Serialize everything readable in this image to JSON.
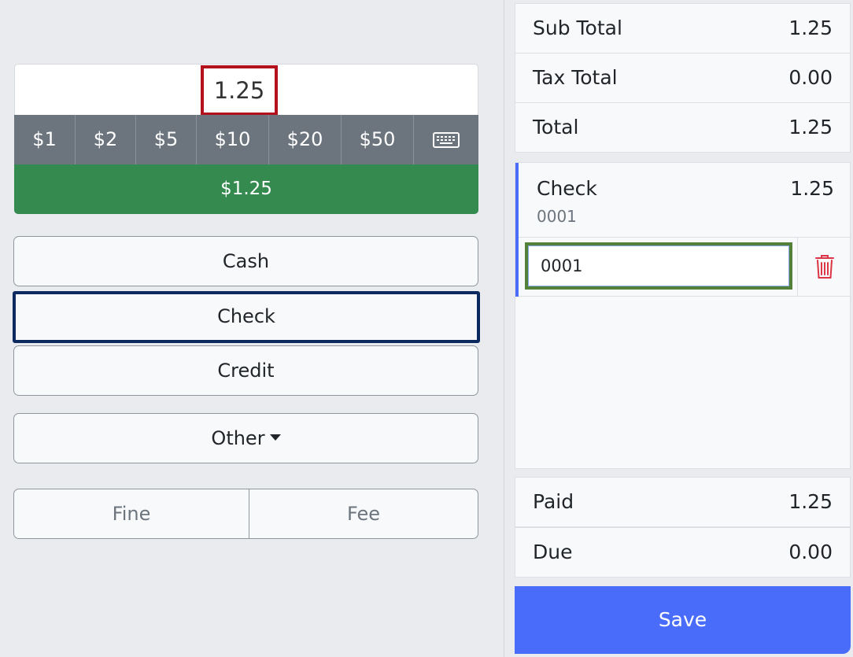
{
  "amount": {
    "value": "1.25"
  },
  "quick_amounts": [
    "$1",
    "$2",
    "$5",
    "$10",
    "$20",
    "$50"
  ],
  "keyboard_icon": "keyboard-icon",
  "exact_amount": "$1.25",
  "methods": {
    "cash": "Cash",
    "check": "Check",
    "credit": "Credit",
    "other": "Other"
  },
  "fine_fee": {
    "fine": "Fine",
    "fee": "Fee"
  },
  "summary": {
    "subtotal_label": "Sub Total",
    "subtotal_value": "1.25",
    "tax_label": "Tax Total",
    "tax_value": "0.00",
    "total_label": "Total",
    "total_value": "1.25"
  },
  "payment": {
    "method": "Check",
    "amount": "1.25",
    "reference": "0001",
    "reference_input_value": "0001",
    "delete_icon": "trash-icon"
  },
  "footer": {
    "paid_label": "Paid",
    "paid_value": "1.25",
    "due_label": "Due",
    "due_value": "0.00"
  },
  "save_label": "Save",
  "colors": {
    "amount_border": "#b3111b",
    "quick_bg": "#6c757d",
    "exact_bg": "#348a4f",
    "active_border": "#0d2a5e",
    "ref_input_border": "#54813a",
    "payment_accent": "#4a6cf7",
    "save_bg": "#4a6cfb",
    "trash": "#dc3545"
  }
}
